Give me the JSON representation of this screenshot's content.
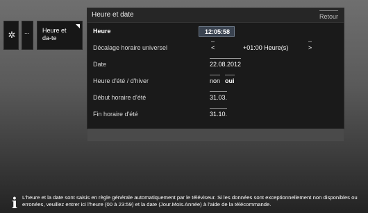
{
  "breadcrumb": {
    "more_label": "...",
    "current_label": "Heure et da-te"
  },
  "panel": {
    "title": "Heure et date",
    "back_label": "Retour"
  },
  "settings": {
    "time_label": "Heure",
    "time_value": "12:05:58",
    "utc_label": "Décalage horaire universel",
    "utc_prev": "<",
    "utc_value": "+01:00 Heure(s)",
    "utc_next": ">",
    "date_label": "Date",
    "date_value": "22.08.2012",
    "dst_label": "Heure d'été / d'hiver",
    "dst_option_no": "non",
    "dst_option_yes": "oui",
    "dst_start_label": "Début horaire d'été",
    "dst_start_value": "31.03.",
    "dst_end_label": "Fin horaire d'été",
    "dst_end_value": "31.10."
  },
  "info": {
    "icon": "i",
    "text": "L'heure et la date sont saisis en règle générale automatiquement par le téléviseur. Si les données sont exceptionnellement non disponibles ou erronées, veuillez entrer ici l'heure (00 à 23:59) et la date (Jour.Mois.Année) à l'aide de la télécommande."
  }
}
